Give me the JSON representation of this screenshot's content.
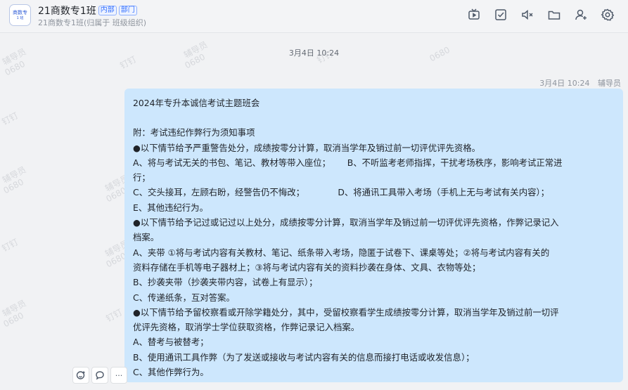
{
  "header": {
    "avatar_line1": "商数专",
    "avatar_line2": "1 班",
    "title": "21商数专1班",
    "tag_internal": "内部",
    "tag_department": "部门",
    "subtitle": "21商数专1班(归属于 班级组织)"
  },
  "toolbar": {
    "icons": [
      "video-icon",
      "task-check-icon",
      "mute-speaker-icon",
      "folder-icon",
      "add-member-icon",
      "settings-icon"
    ]
  },
  "watermark": {
    "text1": "辅导员",
    "text2": "0680",
    "text3": "钉钉"
  },
  "conversation": {
    "center_timestamp": "3月4日 10:24",
    "message": {
      "time": "3月4日 10:24",
      "sender": "辅导员",
      "lines": [
        "2024年专升本诚信考试主题班会",
        "",
        "附：考试违纪作弊行为须知事项",
        "●以下情节给予严重警告处分，成绩按零分计算，取消当学年及销过前一切评优评先资格。",
        "A、将与考试无关的书包、笔记、教材等带入座位；      B、不听监考老师指挥，干扰考场秩序，影响考试正常进",
        "行；",
        "C、交头接耳，左顾右盼，经警告仍不悔改；            D、将通讯工具带入考场（手机上无与考试有关内容）；",
        "E、其他违纪行为。",
        "●以下情节给予记过或记过以上处分，成绩按零分计算，取消当学年及销过前一切评优评先资格，作弊记录记入",
        "档案。",
        "A、夹带 ①将与考试内容有关教材、笔记、纸条带入考场，隐匿于试卷下、课桌等处；②将与考试内容有关的",
        "资料存储在手机等电子器材上；③将与考试内容有关的资料抄袭在身体、文具、衣物等处；",
        "B、抄袭夹带（抄袭夹带内容，试卷上有显示）；",
        "C、传递纸条，互对答案。",
        "●以下情节给予留校察看或开除学籍处分，其中，受留校察看学生成绩按零分计算，取消当学年及销过前一切评",
        "优评先资格，取消学士学位获取资格，作弊记录记入档案。",
        "A、替考与被替考；",
        "B、使用通讯工具作弊（为了发送或接收与考试内容有关的信息而接打电话或收发信息）；",
        "C、其他作弊行为。"
      ]
    },
    "reactions": {
      "more_label": "···"
    }
  }
}
